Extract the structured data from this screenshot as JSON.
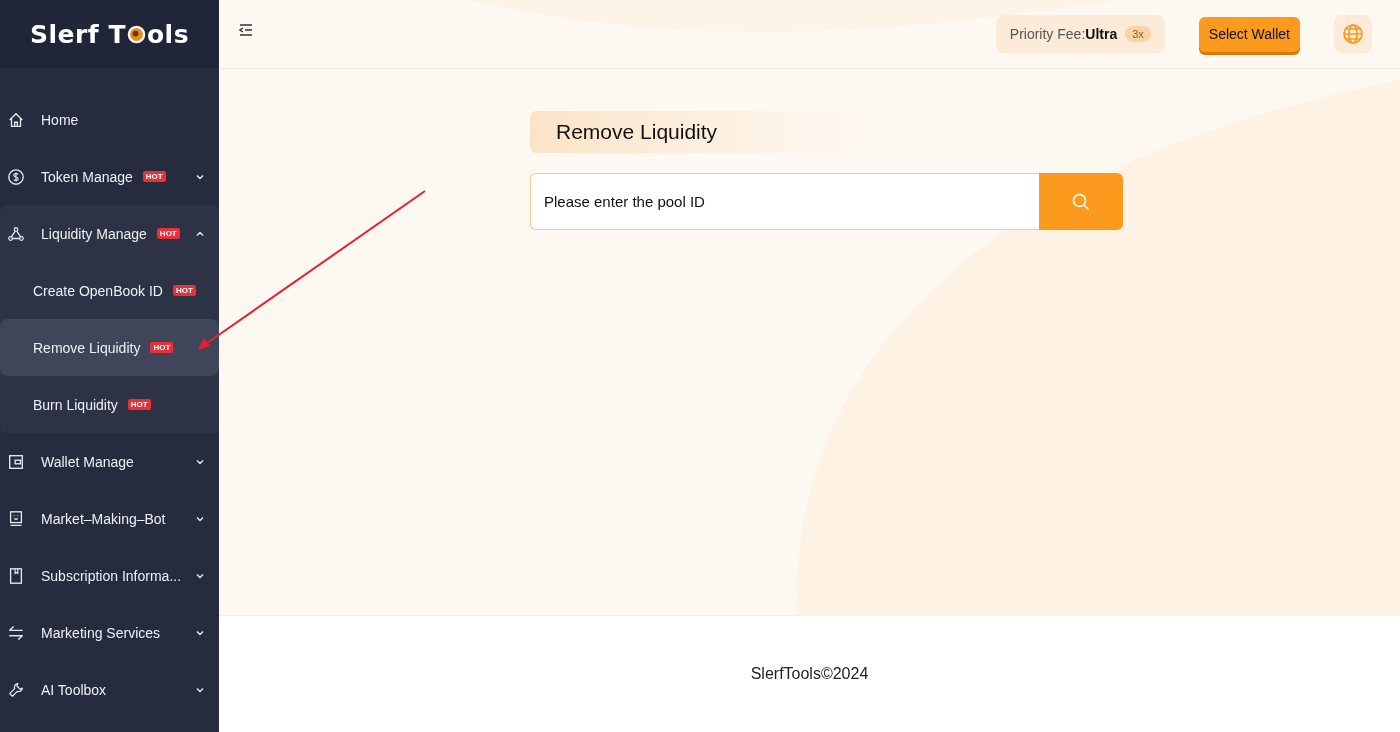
{
  "logo": {
    "text_before": "Slerf T",
    "text_after": "ols"
  },
  "sidebar": {
    "items": [
      {
        "label": "Home",
        "hot": false,
        "expandable": false
      },
      {
        "label": "Token Manage",
        "hot": true,
        "hot_text": "HOT",
        "expandable": true,
        "expanded": false
      },
      {
        "label": "Liquidity Manage",
        "hot": true,
        "hot_text": "HOT",
        "expandable": true,
        "expanded": true,
        "children": [
          {
            "label": "Create OpenBook ID",
            "hot_text": "HOT",
            "selected": false
          },
          {
            "label": "Remove Liquidity",
            "hot_text": "HOT",
            "selected": true
          },
          {
            "label": "Burn Liquidity",
            "hot_text": "HOT",
            "selected": false
          }
        ]
      },
      {
        "label": "Wallet Manage",
        "hot": false,
        "expandable": true,
        "expanded": false
      },
      {
        "label": "Market–Making–Bot",
        "hot": false,
        "expandable": true,
        "expanded": false
      },
      {
        "label": "Subscription Informa...",
        "hot": false,
        "expandable": true,
        "expanded": false
      },
      {
        "label": "Marketing Services",
        "hot": false,
        "expandable": true,
        "expanded": false
      },
      {
        "label": "AI Toolbox",
        "hot": false,
        "expandable": true,
        "expanded": false
      }
    ]
  },
  "topbar": {
    "priority_label": "Priority Fee:",
    "priority_value": "Ultra",
    "multiplier": "3x",
    "wallet_button": "Select Wallet"
  },
  "page": {
    "title": "Remove Liquidity",
    "search": {
      "placeholder": "Please enter the pool ID"
    }
  },
  "footer": "SlerfTools©2024"
}
